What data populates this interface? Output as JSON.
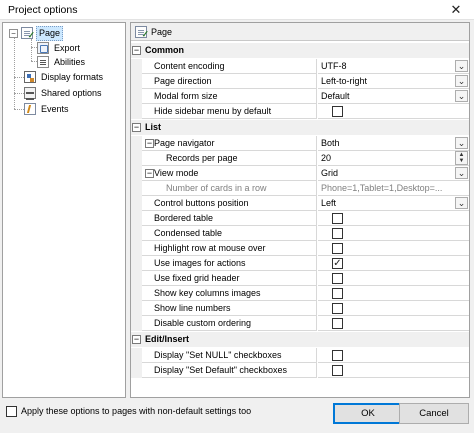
{
  "window": {
    "title": "Project options",
    "close_glyph": "✕"
  },
  "tree": {
    "items": [
      {
        "label": "Page",
        "icon": "page-icon",
        "selected": true,
        "expander": "−"
      },
      {
        "label": "Export",
        "icon": "export-icon"
      },
      {
        "label": "Abilities",
        "icon": "abilities-icon"
      },
      {
        "label": "Display formats",
        "icon": "display-formats-icon"
      },
      {
        "label": "Shared options",
        "icon": "shared-options-icon"
      },
      {
        "label": "Events",
        "icon": "events-icon"
      }
    ]
  },
  "panel": {
    "header": "Page"
  },
  "grid": {
    "categories": [
      {
        "label": "Common",
        "toggle": "−"
      },
      {
        "label": "List",
        "toggle": "−"
      },
      {
        "label": "Edit/Insert",
        "toggle": "−"
      }
    ],
    "rows": {
      "content_encoding": {
        "name": "Content encoding",
        "value": "UTF-8"
      },
      "page_direction": {
        "name": "Page direction",
        "value": "Left-to-right"
      },
      "modal_form_size": {
        "name": "Modal form size",
        "value": "Default"
      },
      "hide_sidebar": {
        "name": "Hide sidebar menu by default",
        "checked": false
      },
      "page_navigator": {
        "name": "Page navigator",
        "value": "Both",
        "toggle": "−"
      },
      "records_per_page": {
        "name": "Records per page",
        "value": "20"
      },
      "view_mode": {
        "name": "View mode",
        "value": "Grid",
        "toggle": "−"
      },
      "cards_in_row": {
        "name": "Number of cards in a row",
        "value": "Phone=1,Tablet=1,Desktop=..."
      },
      "control_buttons_position": {
        "name": "Control buttons position",
        "value": "Left"
      },
      "bordered_table": {
        "name": "Bordered table",
        "checked": false
      },
      "condensed_table": {
        "name": "Condensed table",
        "checked": false
      },
      "highlight_row": {
        "name": "Highlight row at mouse over",
        "checked": false
      },
      "use_images": {
        "name": "Use images for actions",
        "checked": true
      },
      "fixed_grid_header": {
        "name": "Use fixed grid header",
        "checked": false
      },
      "key_columns_images": {
        "name": "Show key columns images",
        "checked": false
      },
      "line_numbers": {
        "name": "Show line numbers",
        "checked": false
      },
      "disable_ordering": {
        "name": "Disable custom ordering",
        "checked": false
      },
      "set_null": {
        "name": "Display \"Set NULL\" checkboxes",
        "checked": false
      },
      "set_default": {
        "name": "Display \"Set Default\" checkboxes",
        "checked": false
      }
    },
    "dropdown_glyph": "⌄",
    "spin_up": "▲",
    "spin_down": "▼",
    "check_glyph": "✓"
  },
  "footer": {
    "apply_label": "Apply these options to pages with non-default settings too",
    "apply_checked": false,
    "ok_label": "OK",
    "cancel_label": "Cancel"
  },
  "colors": {
    "selection": "#cce8ff",
    "default_button_border": "#0078d7"
  }
}
